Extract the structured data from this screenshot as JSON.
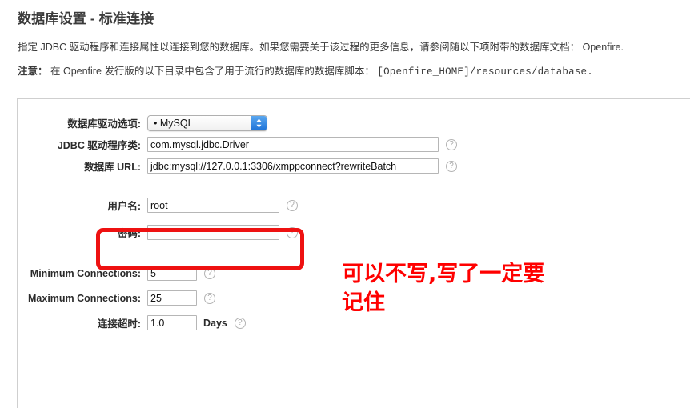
{
  "header": {
    "title": "数据库设置 - 标准连接",
    "intro": "指定 JDBC 驱动程序和连接属性以连接到您的数据库。如果您需要关于该过程的更多信息，请参阅随以下项附带的数据库文档： Openfire.",
    "note_label": "注意：",
    "note_text": "在 Openfire 发行版的以下目录中包含了用于流行的数据库的数据库脚本：",
    "note_path": "[Openfire_HOME]/resources/database."
  },
  "form": {
    "driver_preset": {
      "label": "数据库驱动选项:",
      "value": "• MySQL",
      "options": [
        "• MySQL"
      ]
    },
    "driver_class": {
      "label": "JDBC 驱动程序类:",
      "value": "com.mysql.jdbc.Driver",
      "placeholder": ""
    },
    "database_url": {
      "label": "数据库 URL:",
      "value": "jdbc:mysql://127.0.0.1:3306/xmppconnect?rewriteBatch",
      "placeholder": ""
    },
    "username": {
      "label": "用户名:",
      "value": "root",
      "placeholder": ""
    },
    "password": {
      "label": "密码:",
      "value": "",
      "placeholder": ""
    },
    "min_connections": {
      "label": "Minimum Connections:",
      "value": "5"
    },
    "max_connections": {
      "label": "Maximum Connections:",
      "value": "25"
    },
    "connection_timeout": {
      "label": "连接超时:",
      "value": "1.0",
      "unit": "Days"
    },
    "help_glyph": "?"
  },
  "annotations": {
    "marker_note": "可以不写,写了一定要\n记住",
    "marker_color": "#ff0000"
  }
}
